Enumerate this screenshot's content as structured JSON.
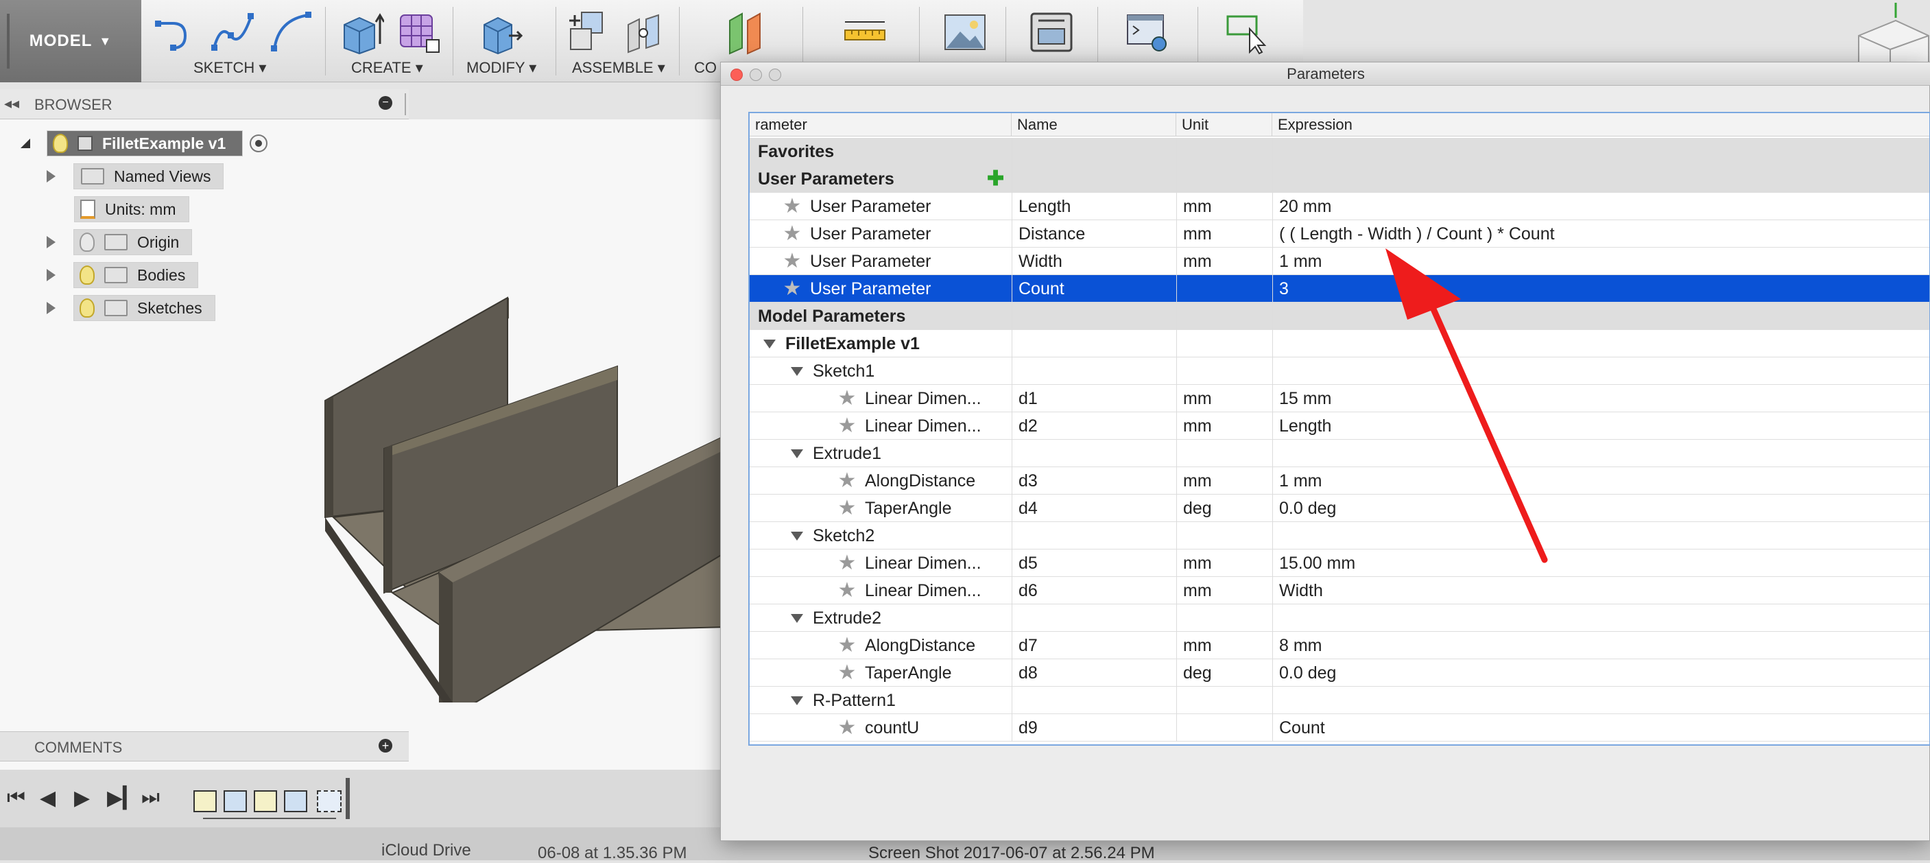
{
  "toolbar": {
    "model_label": "MODEL",
    "groups": [
      {
        "label": "SKETCH"
      },
      {
        "label": "CREATE"
      },
      {
        "label": "MODIFY"
      },
      {
        "label": "ASSEMBLE"
      },
      {
        "label": "CO"
      }
    ]
  },
  "browser": {
    "title": "BROWSER",
    "root": "FilletExample v1",
    "items": [
      {
        "label": "Named Views"
      },
      {
        "label": "Units: mm"
      },
      {
        "label": "Origin"
      },
      {
        "label": "Bodies"
      },
      {
        "label": "Sketches"
      }
    ]
  },
  "comments": {
    "title": "COMMENTS"
  },
  "dock": {
    "items": [
      "iCloud Drive",
      "06-08 at 1.35.36 PM",
      "Screen Shot 2017-06-07 at 2.56.24 PM"
    ]
  },
  "dialog": {
    "title": "Parameters",
    "columns": [
      "rameter",
      "Name",
      "Unit",
      "Expression"
    ],
    "groups": {
      "favorites": "Favorites",
      "user": "User Parameters",
      "model": "Model Parameters"
    },
    "user_params": [
      {
        "param": "User Parameter",
        "name": "Length",
        "unit": "mm",
        "expr": "20 mm"
      },
      {
        "param": "User Parameter",
        "name": "Distance",
        "unit": "mm",
        "expr": "( ( Length - Width ) / Count ) * Count"
      },
      {
        "param": "User Parameter",
        "name": "Width",
        "unit": "mm",
        "expr": "1 mm"
      },
      {
        "param": "User Parameter",
        "name": "Count",
        "unit": "",
        "expr": "3"
      }
    ],
    "model_root": "FilletExample v1",
    "features": [
      {
        "name": "Sketch1",
        "params": [
          {
            "param": "Linear Dimen...",
            "name": "d1",
            "unit": "mm",
            "expr": "15 mm"
          },
          {
            "param": "Linear Dimen...",
            "name": "d2",
            "unit": "mm",
            "expr": "Length"
          }
        ]
      },
      {
        "name": "Extrude1",
        "params": [
          {
            "param": "AlongDistance",
            "name": "d3",
            "unit": "mm",
            "expr": "1 mm"
          },
          {
            "param": "TaperAngle",
            "name": "d4",
            "unit": "deg",
            "expr": "0.0 deg"
          }
        ]
      },
      {
        "name": "Sketch2",
        "params": [
          {
            "param": "Linear Dimen...",
            "name": "d5",
            "unit": "mm",
            "expr": "15.00 mm"
          },
          {
            "param": "Linear Dimen...",
            "name": "d6",
            "unit": "mm",
            "expr": "Width"
          }
        ]
      },
      {
        "name": "Extrude2",
        "params": [
          {
            "param": "AlongDistance",
            "name": "d7",
            "unit": "mm",
            "expr": "8 mm"
          },
          {
            "param": "TaperAngle",
            "name": "d8",
            "unit": "deg",
            "expr": "0.0 deg"
          }
        ]
      },
      {
        "name": "R-Pattern1",
        "params": [
          {
            "param": "countU",
            "name": "d9",
            "unit": "",
            "expr": "Count"
          }
        ]
      }
    ]
  },
  "colors": {
    "selection": "#0a52d6",
    "arrow": "#ee1c1c",
    "model_body": "#5f5a51"
  }
}
